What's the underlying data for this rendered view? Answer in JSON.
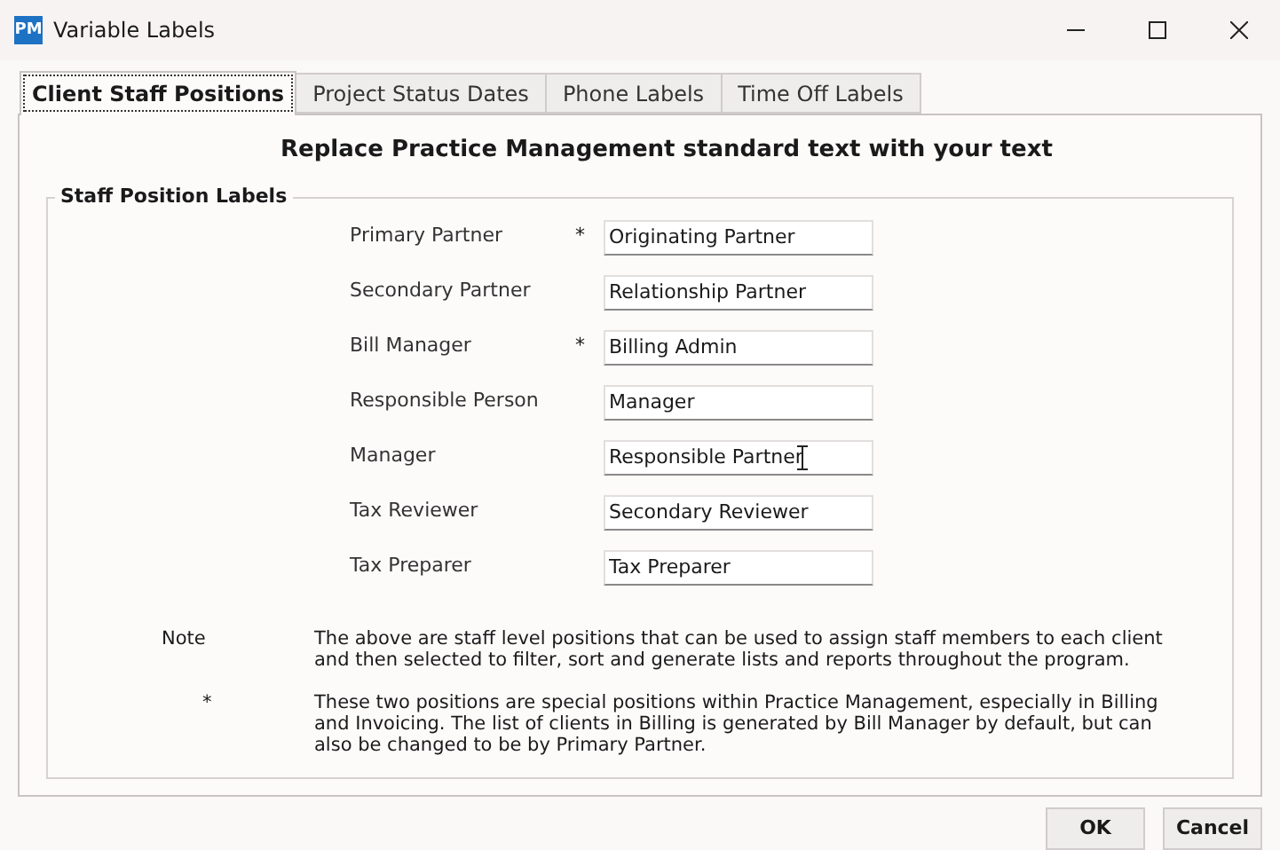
{
  "window": {
    "title": "Variable Labels",
    "app_icon": "PM"
  },
  "tabs": [
    {
      "label": "Client Staff Positions",
      "selected": true
    },
    {
      "label": "Project Status Dates",
      "selected": false
    },
    {
      "label": "Phone Labels",
      "selected": false
    },
    {
      "label": "Time Off Labels",
      "selected": false
    }
  ],
  "heading": "Replace Practice Management standard text with your text",
  "group": {
    "title": "Staff Position Labels",
    "fields": [
      {
        "label": "Primary Partner",
        "mark": "*",
        "value": "Originating Partner",
        "text_cursor": false
      },
      {
        "label": "Secondary Partner",
        "value": "Relationship Partner",
        "text_cursor": false
      },
      {
        "label": "Bill Manager",
        "mark": "*",
        "value": "Billing Admin",
        "text_cursor": false
      },
      {
        "label": "Responsible Person",
        "value": "Manager",
        "text_cursor": false
      },
      {
        "label": "Manager",
        "value": "Responsible Partner",
        "text_cursor": true
      },
      {
        "label": "Tax Reviewer",
        "value": "Secondary Reviewer",
        "text_cursor": false
      },
      {
        "label": "Tax Preparer",
        "value": "Tax Preparer",
        "text_cursor": false
      }
    ],
    "notes": [
      {
        "term": "Note",
        "text": "The above are staff level positions that can be used to assign staff members to each client and then selected to filter, sort and generate lists and reports throughout the program."
      },
      {
        "term": "*",
        "text": "These two positions are special positions within Practice Management, especially in Billing and Invoicing.  The list of clients in Billing is generated by Bill Manager by default, but can also be changed to be by Primary Partner."
      }
    ]
  },
  "buttons": [
    "OK",
    "Cancel"
  ]
}
